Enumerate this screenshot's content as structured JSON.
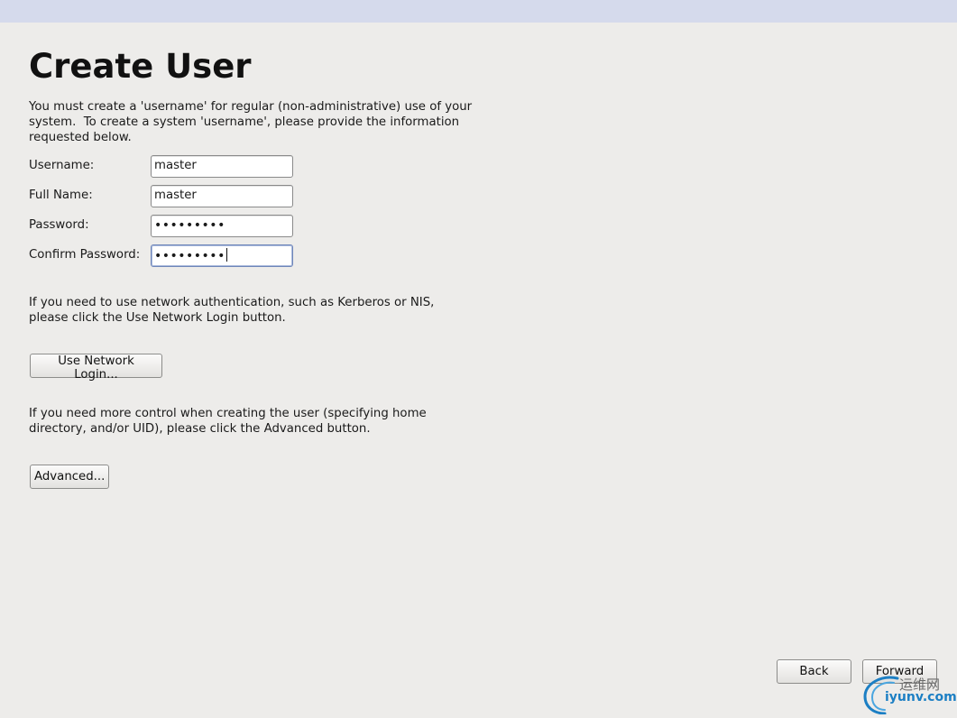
{
  "page": {
    "title": "Create User",
    "intro_lines": [
      "You must create a 'username' for regular (non-administrative) use of your",
      "system.  To create a system 'username', please provide the information",
      "requested below."
    ]
  },
  "form": {
    "username": {
      "label": "Username:",
      "value": "master"
    },
    "full_name": {
      "label": "Full Name:",
      "value": "master"
    },
    "password": {
      "label": "Password:",
      "value": "•••••••••"
    },
    "confirm_password": {
      "label": "Confirm Password:",
      "value": "•••••••••"
    }
  },
  "network": {
    "text_lines": [
      "If you need to use network authentication, such as Kerberos or NIS,",
      "please click the Use Network Login button."
    ],
    "button_label": "Use Network Login..."
  },
  "advanced": {
    "text_lines": [
      "If you need more control when creating the user (specifying home",
      "directory, and/or UID), please click the Advanced button."
    ],
    "button_label": "Advanced..."
  },
  "navigation": {
    "back_label": "Back",
    "forward_label": "Forward"
  },
  "watermark": {
    "cn_text": "运维网",
    "en_text": "iyunv.com"
  },
  "colors": {
    "background": "#edecea",
    "top_bar": "#d5daec",
    "focus_border": "#6f86b9",
    "watermark_blue": "#1c7fc4"
  }
}
